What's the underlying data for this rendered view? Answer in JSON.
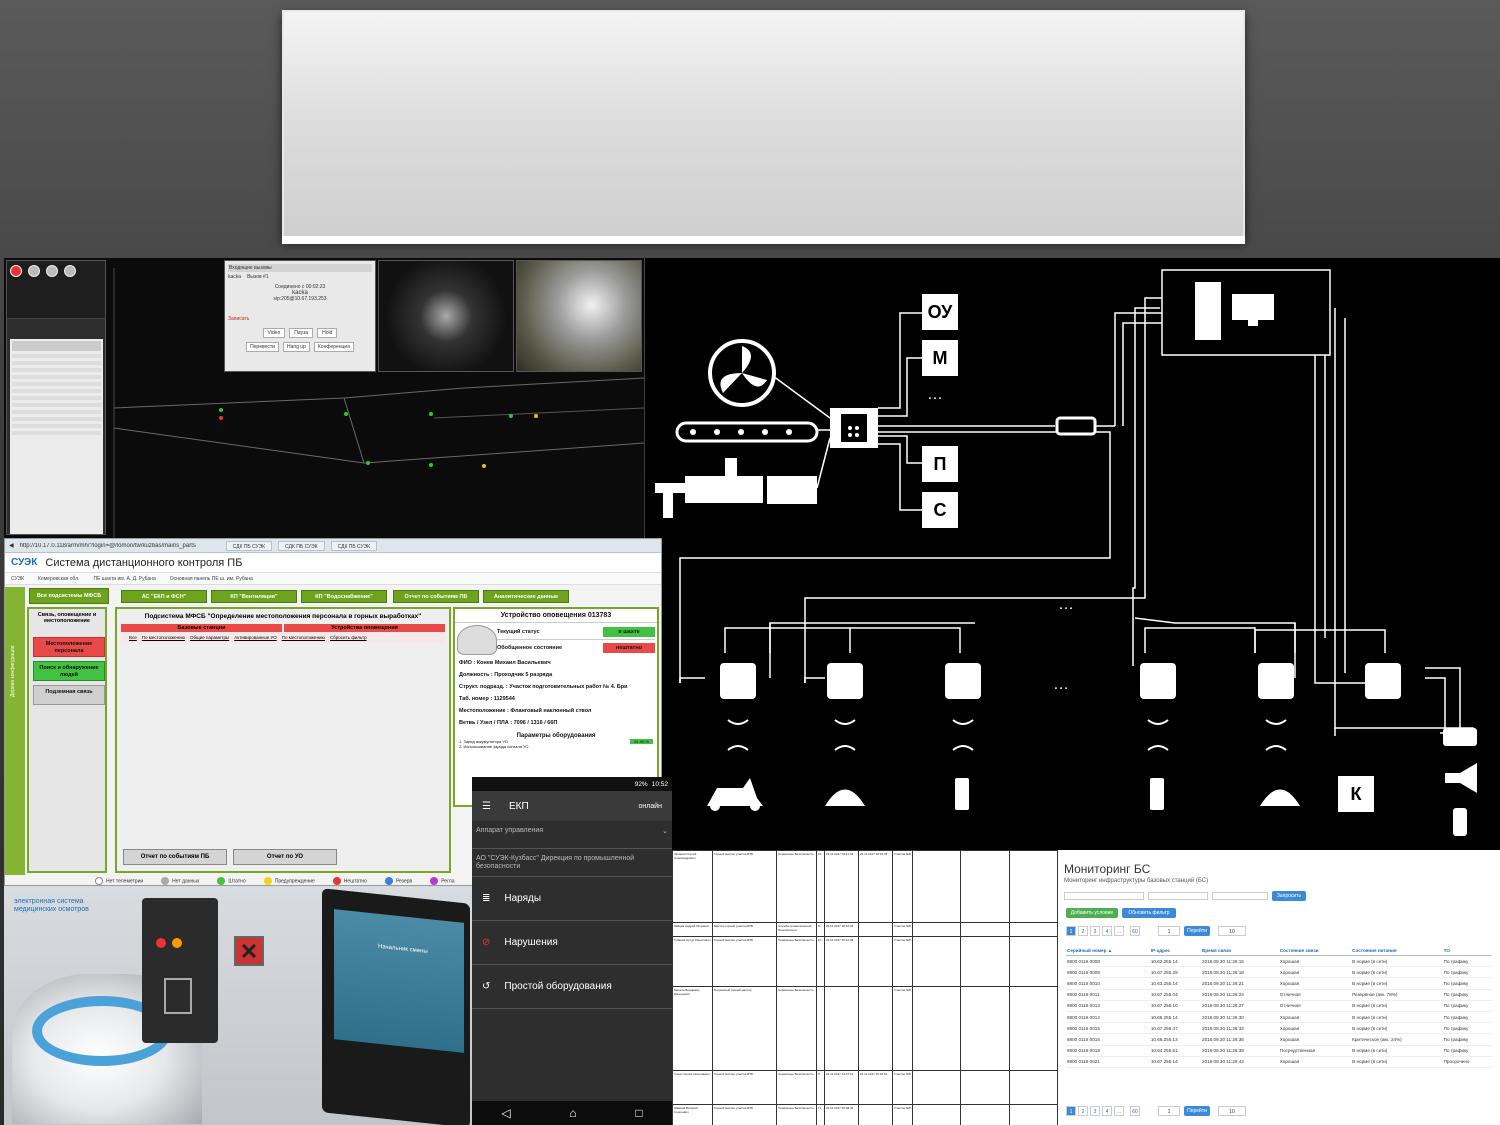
{
  "colors": {
    "accent_green": "#6ea31e",
    "alert_red": "#e84a4a",
    "link_blue": "#1c6fb8",
    "diagram_bg": "#000000"
  },
  "monitoring_3d": {
    "dialog_title": "Входящие вызовы",
    "dialog_tabs": [
      "kacka",
      "Вызов #1"
    ],
    "caller": "kacka",
    "caller_ip": "sip:205@10.67.193.253",
    "buttons": [
      "Video",
      "Пауза",
      "Hold",
      "Перевести",
      "Hang up",
      "Конференция"
    ],
    "record_label": "Записать",
    "connected_label": "Соединено с",
    "time": "00:02:23"
  },
  "system_diagram": {
    "labels": [
      "ОУ",
      "М",
      "…",
      "П",
      "С",
      "К"
    ],
    "ellipsis": "…"
  },
  "browser": {
    "url": "http://10.17.0.118/arm/mh/?login=@/lomon/tw/kuzbas/mains_parts",
    "tabs": [
      "СДК ПБ СУЭК",
      "СДК ПБ СУЭК",
      "СДК ПБ СУЭК"
    ],
    "logo": "СУЭК",
    "app_title": "Система дистанционного контроля ПБ",
    "breadcrumb": [
      "СУЭК",
      "Кемеровская обл.",
      "ПЕ шахта им. А. Д. Рубана",
      "Основная панель ПЕ ш. им. Рубана"
    ],
    "top_buttons": [
      "Все подсистемы МФСБ",
      "АС \"ЕКП и ФСН\"",
      "КП \"Вентиляция\"",
      "КП \"Водоснабжение\"",
      "Отчет по событиям ПБ",
      "Аналитические данные"
    ],
    "side_header": "Связь, оповещение и местоположение",
    "side_buttons": [
      "Местоположение персонала",
      "Поиск и обнаружение людей",
      "Подземная связь"
    ],
    "vertical_label": "Дерево конфигурации",
    "mid_title": "Подсистема МФСБ \"Определение местоположения персонала в горных выработках\"",
    "mid_tabs": [
      "Базовые станции",
      "Устройства оповещения"
    ],
    "mid_subtabs": [
      "Все",
      "По местоположению",
      "Общие параметры",
      "Активированные УО",
      "По местоположению",
      "Сбросить фильтр"
    ],
    "mid_bottom_buttons": [
      "Отчет по событиям ПБ",
      "Отчет по УО"
    ],
    "device_title": "Устройство оповещения 013783",
    "status_rows": [
      {
        "label": "Текущий статус",
        "value": "в шахте"
      },
      {
        "label": "Обобщенное состояние",
        "value": "нештатно"
      }
    ],
    "person": [
      {
        "label": "ФИО :",
        "value": "Конев Михаил Васильевич"
      },
      {
        "label": "Должность :",
        "value": "Проходчик 5 разряда"
      },
      {
        "label": "Структ. подразд. :",
        "value": "Участок подготовительных работ № 4. Бри"
      },
      {
        "label": "Таб. номер :",
        "value": "1129544"
      },
      {
        "label": "Местоположение :",
        "value": "Фланговый наклонный ствол"
      },
      {
        "label": "Ветвь / Узел / ПЛА :",
        "value": "7096 / 1316 / 66П"
      }
    ],
    "equip_title": "Параметры оборудования",
    "equip_rows": [
      "1. Заряд аккумулятора УО",
      "2. Использование заряда сигнала УО"
    ],
    "equip_value": "81.90 %",
    "legend": [
      "Нет телеметрии",
      "Нет данных",
      "Штатно",
      "Предупреждение",
      "Нештатно",
      "Резерв",
      "Регла"
    ]
  },
  "kiosk_photo": {
    "brand_line1": "электронная система",
    "brand_line2": "медицинских осмотров",
    "screen_text": "Начальник смены"
  },
  "android_app": {
    "status_time": "10:52",
    "battery": "92%",
    "title": "ЕКП",
    "mode": "онлайн",
    "select1": "Аппарат управления",
    "select2": "АО \"СУЭК-Кузбасс\" Дирекция по промышленной безопасности",
    "items": [
      "Наряды",
      "Нарушения",
      "Простой оборудования"
    ]
  },
  "document_table": {
    "rows": [
      [
        "Захаров Сергей Александрович",
        "Горный мастер участка ВТБ",
        "Сервисные Безопасность",
        "10",
        "24.11.2017 03:31:33",
        "24.11.2017 18:32:45",
        "Участок №8"
      ],
      [
        "Зайцев Андрей Игоревич",
        "Мастер горный участка ВТБ",
        "Служба промышленной безопасности",
        "8",
        "24.11.2017 18:32:45",
        "",
        "Участок №8"
      ],
      [
        "Губанов Артур Рашитович",
        "Горный мастер участка ВТБ",
        "Сервисные Безопасность",
        "10",
        "24.11.2017 15:42:38",
        "",
        "Участок №8"
      ],
      [
        "Михель Владимир Евгеньевич",
        "Подземный горный мастер",
        "Сервисные Безопасность",
        "",
        "",
        "",
        "Участок №8"
      ],
      [
        "Гусев Сергей Николаевич",
        "Горный мастер участка ВТБ",
        "Сервисные Безопасность",
        "8",
        "24.11.2017 14:07:12",
        "24.11.2017 15:20:51",
        "Участок №8"
      ],
      [
        "Шмаков Виталий Сергеевич",
        "Горный мастер участка ВТБ",
        "Сервисные Безопасность",
        "11",
        "24.11.2017 15:38:46",
        "",
        "Участок №8"
      ]
    ]
  },
  "bs_monitoring": {
    "title": "Мониторинг БС",
    "subtitle": "Мониторинг инфраструктуры базовых станций (БС)",
    "query_button": "Запросить",
    "add_condition": "Добавить условие",
    "refresh_filter": "Обновить фильтр",
    "pages": [
      "1",
      "2",
      "3",
      "4",
      "...",
      "60"
    ],
    "page_input": "1",
    "goto_button": "Перейти",
    "per_page": "10",
    "columns": [
      "Серийный номер ▲",
      "IP-адрес",
      "Время связи",
      "Состояние связи",
      "Состояние питания",
      "ТО"
    ],
    "rows": [
      [
        "6900 0116 0008",
        "10.62.255.14",
        "2018.08.30 11:26:15",
        "Хорошая",
        "В норме (в сети)",
        "По графику"
      ],
      [
        "6900 0116 0009",
        "10.67.255.29",
        "2018.08.30 11:26:18",
        "Хорошая",
        "В норме (в сети)",
        "По графику"
      ],
      [
        "6900 0116 0010",
        "10.63.255.14",
        "2018.08.30 11:26:21",
        "Хорошая",
        "В норме (в сети)",
        "По графику"
      ],
      [
        "6900 0116 0011",
        "10.67.255.04",
        "2018.08.30 11:26:24",
        "Отличная",
        "Резервное (акк. 78%)",
        "По графику"
      ],
      [
        "6900 0116 0013",
        "10.67.255.10",
        "2018.08.30 11:26:27",
        "Отличная",
        "В норме (в сети)",
        "По графику"
      ],
      [
        "6900 0116 0014",
        "10.65.255.14",
        "2018.08.30 11:26:30",
        "Хорошая",
        "В норме (в сети)",
        "По графику"
      ],
      [
        "6900 0116 0015",
        "10.67.255.47",
        "2018.08.30 11:26:33",
        "Хорошая",
        "В норме (в сети)",
        "По графику"
      ],
      [
        "6900 0116 0016",
        "10.66.255.13",
        "2018.08.30 11:26:36",
        "Хорошая",
        "Критическое (акк. 24%)",
        "По графику"
      ],
      [
        "6900 0116 0018",
        "10.64.255.61",
        "2018.08.30 11:26:39",
        "Посредственная",
        "В норме (в сети)",
        "По графику"
      ],
      [
        "6900 0116 0021",
        "10.67.255.14",
        "2018.08.30 11:26:42",
        "Хорошая",
        "В норме (в сети)",
        "Просрочено"
      ]
    ]
  }
}
